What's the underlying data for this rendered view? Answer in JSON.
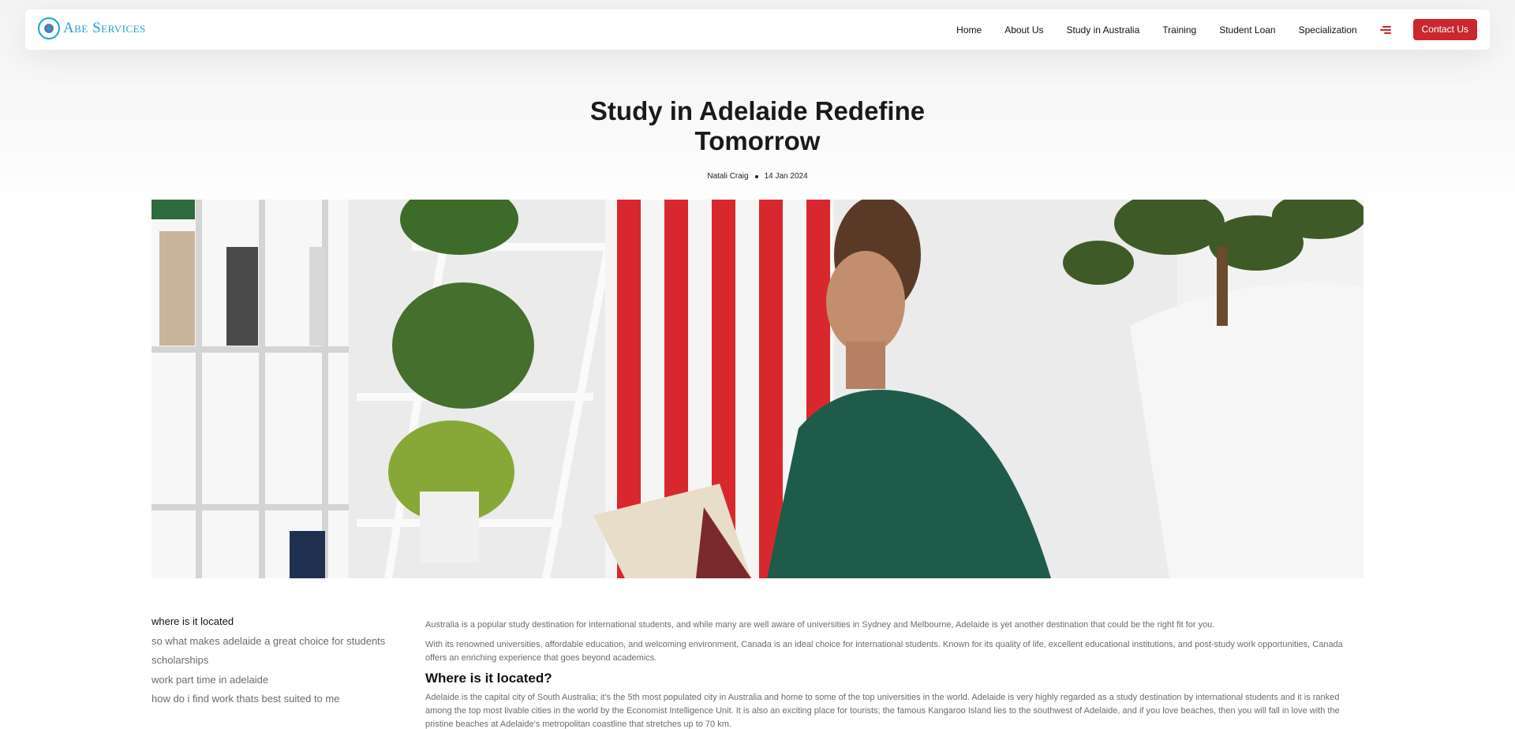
{
  "brand": {
    "name": "Abe Services",
    "mark": "®"
  },
  "nav": {
    "links": [
      "Home",
      "About Us",
      "Study in Australia",
      "Training",
      "Student Loan",
      "Specialization"
    ],
    "contact_label": "Contact Us"
  },
  "post": {
    "title_line1": "Study in Adelaide Redefine",
    "title_line2": "Tomorrow",
    "author": "Natali Craig",
    "date": "14 Jan 2024"
  },
  "toc": {
    "items": [
      "where is it located",
      "so what makes adelaide a great choice for students",
      "scholarships",
      "work part time in adelaide",
      "how do i find work thats best suited to me"
    ]
  },
  "article": {
    "p1": "Australia is a popular study destination for international students, and while many are well aware of universities in Sydney and Melbourne, Adelaide is yet another destination that could be the right fit for you.",
    "p2": "With its renowned universities, affordable education, and welcoming environment, Canada is an ideal choice for international students. Known for its quality of life, excellent educational institutions, and post-study work opportunities, Canada offers an enriching experience that goes beyond academics.",
    "h2": "Where is it located?",
    "p3": "Adelaide is the capital city of South Australia; it's the 5th most populated city in Australia and home to some of the top universities in the world. Adelaide is very highly regarded as a study destination by international students and it is ranked among the top most livable cities in the world by the Economist Intelligence Unit. It is also an exciting place for tourists; the famous Kangaroo Island lies to the southwest of Adelaide, and if you love beaches, then you will fall in love with the pristine beaches at Adelaide's metropolitan coastline that stretches up to 70 km."
  },
  "colors": {
    "accent": "#c8282e",
    "brand": "#1ea3da"
  },
  "icons": {
    "menu": "hamburger-menu-icon",
    "logo": "abe-services-logo"
  }
}
